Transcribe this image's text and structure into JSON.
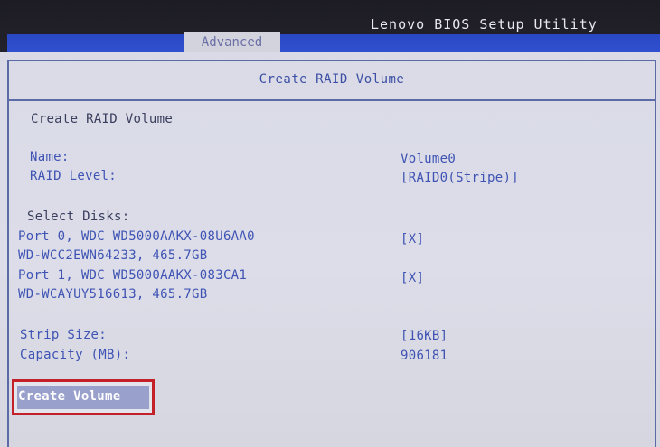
{
  "header": {
    "app_title": "Lenovo BIOS Setup Utility",
    "active_tab": "Advanced"
  },
  "panel": {
    "title": "Create RAID Volume"
  },
  "content": {
    "section_title": "Create RAID Volume",
    "name_label": "Name:",
    "name_value": "Volume0",
    "raid_level_label": "RAID Level:",
    "raid_level_value": "[RAID0(Stripe)]",
    "select_disks_label": "Select Disks:",
    "disks": [
      {
        "line1": "Port 0, WDC WD5000AAKX-08U6AA0",
        "line2": "WD-WCC2EWN64233, 465.7GB",
        "value": "[X]"
      },
      {
        "line1": "Port 1, WDC WD5000AAKX-083CA1",
        "line2": "WD-WCAYUY516613, 465.7GB",
        "value": "[X]"
      }
    ],
    "strip_size_label": "Strip Size:",
    "strip_size_value": "[16KB]",
    "capacity_label": "Capacity (MB):",
    "capacity_value": "906181",
    "create_button_label": "Create Volume"
  },
  "colors": {
    "header_bg": "#1d1c24",
    "header_blue": "#2f50d0",
    "text_blue": "#3e53b4",
    "text_dark": "#3a3e5e",
    "highlight_border": "#c4202a"
  }
}
